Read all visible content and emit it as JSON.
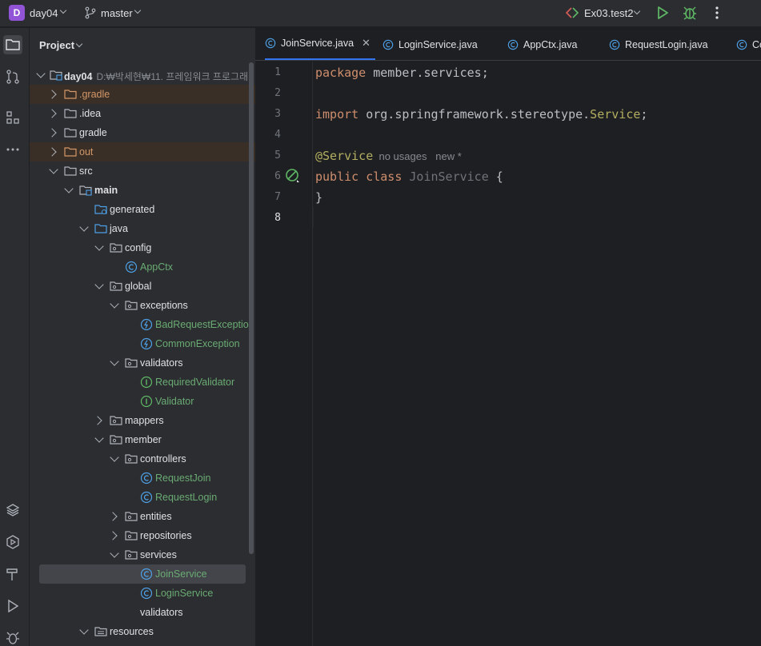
{
  "titlebar": {
    "project_badge": "D",
    "project_name": "day04",
    "branch": "master",
    "run_config": "Ex03.test2"
  },
  "panel": {
    "title": "Project",
    "root_name": "day04",
    "root_path": "D:₩박세현₩11. 프레임워크 프로그래",
    "items": [
      {
        "label": ".gradle"
      },
      {
        "label": ".idea"
      },
      {
        "label": "gradle"
      },
      {
        "label": "out"
      },
      {
        "label": "src"
      },
      {
        "label": "main"
      },
      {
        "label": "generated"
      },
      {
        "label": "java"
      },
      {
        "label": "config"
      },
      {
        "label": "AppCtx"
      },
      {
        "label": "global"
      },
      {
        "label": "exceptions"
      },
      {
        "label": "BadRequestException"
      },
      {
        "label": "CommonException"
      },
      {
        "label": "validators"
      },
      {
        "label": "RequiredValidator"
      },
      {
        "label": "Validator"
      },
      {
        "label": "mappers"
      },
      {
        "label": "member"
      },
      {
        "label": "controllers"
      },
      {
        "label": "RequestJoin"
      },
      {
        "label": "RequestLogin"
      },
      {
        "label": "entities"
      },
      {
        "label": "repositories"
      },
      {
        "label": "services"
      },
      {
        "label": "JoinService"
      },
      {
        "label": "LoginService"
      },
      {
        "label": "validators"
      },
      {
        "label": "resources"
      }
    ]
  },
  "tabs": [
    {
      "label": "JoinService.java"
    },
    {
      "label": "LoginService.java"
    },
    {
      "label": "AppCtx.java"
    },
    {
      "label": "RequestLogin.java"
    },
    {
      "label": "Co"
    }
  ],
  "editor": {
    "line_numbers": [
      "1",
      "2",
      "3",
      "4",
      "5",
      "6",
      "7",
      "8"
    ],
    "line1_kw": "package",
    "line1_rest": " member.services;",
    "line3_kw": "import",
    "line3_pkg": " org.springframework.stereotype.",
    "line3_cls": "Service",
    "line3_end": ";",
    "line5_ann": "@Service",
    "line5_hint": "  no usages   new *",
    "line6_kw": "public class",
    "line6_name": " JoinService",
    "line6_end": " {",
    "line7": "}"
  }
}
